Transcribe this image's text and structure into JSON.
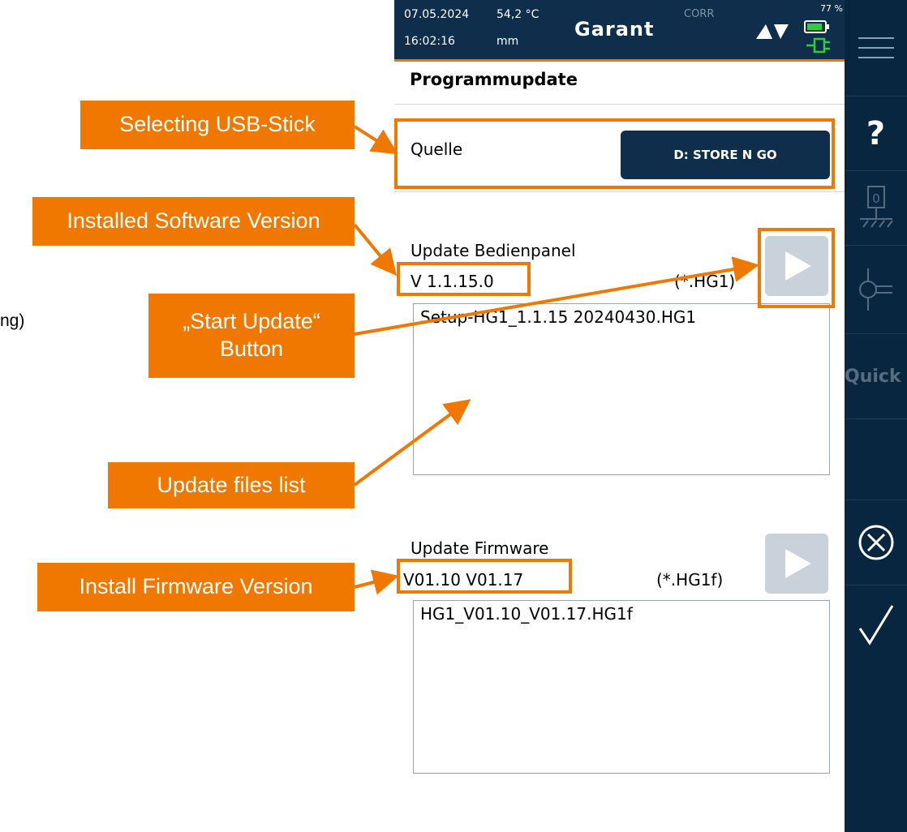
{
  "status": {
    "date": "07.05.2024",
    "time": "16:02:16",
    "temperature": "54,2 °C",
    "unit": "mm",
    "brand": "Garant",
    "corr": "CORR",
    "battery_percent": "77 %"
  },
  "page": {
    "title": "Programmupdate"
  },
  "source": {
    "label": "Quelle",
    "button": "D:  STORE N GO"
  },
  "panel_update": {
    "title": "Update Bedienpanel",
    "version": "V 1.1.15.0",
    "filter": "(*.HG1)",
    "files": [
      "Setup-HG1_1.1.15 20240430.HG1"
    ]
  },
  "firmware_update": {
    "title": "Update Firmware",
    "version": "V01.10  V01.17",
    "filter": "(*.HG1f)",
    "files": [
      "HG1_V01.10_V01.17.HG1f"
    ]
  },
  "sidebar": {
    "quick": "Quick",
    "help": "?",
    "zero_label": "0"
  },
  "callouts": {
    "usb": "Selecting USB-Stick",
    "software": "Installed Software Version",
    "start_line1": "„Start Update“",
    "start_line2": "Button",
    "files": "Update files list",
    "firmware": "Install Firmware Version"
  },
  "cropped_text": "ng)",
  "colors": {
    "accent": "#f07800",
    "header": "#0e2e4c",
    "sidebar": "#08263f",
    "battery": "#2ecc40"
  }
}
